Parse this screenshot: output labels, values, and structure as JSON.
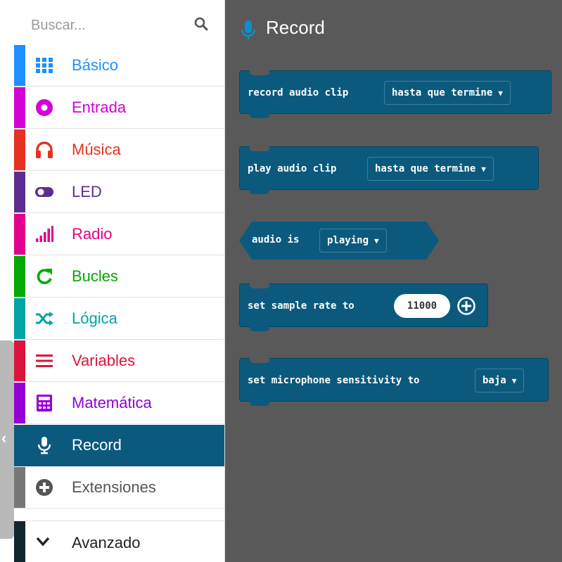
{
  "search": {
    "placeholder": "Buscar..."
  },
  "categories": [
    {
      "label": "Básico",
      "color": "#1e90ff",
      "icon": "grid-icon"
    },
    {
      "label": "Entrada",
      "color": "#d400d4",
      "icon": "circle-dot-icon"
    },
    {
      "label": "Música",
      "color": "#e63022",
      "icon": "headphones-icon"
    },
    {
      "label": "LED",
      "color": "#5c2d91",
      "icon": "toggle-icon"
    },
    {
      "label": "Radio",
      "color": "#e3008c",
      "icon": "signal-bars-icon"
    },
    {
      "label": "Bucles",
      "color": "#00aa00",
      "icon": "refresh-icon"
    },
    {
      "label": "Lógica",
      "color": "#00a4a6",
      "icon": "shuffle-icon"
    },
    {
      "label": "Variables",
      "color": "#dc143c",
      "icon": "list-icon"
    },
    {
      "label": "Matemática",
      "color": "#9400d3",
      "icon": "calculator-icon"
    },
    {
      "label": "Record",
      "color": "#0b5a7e",
      "icon": "microphone-icon",
      "selected": true
    },
    {
      "label": "Extensiones",
      "color": "#777777",
      "icon": "plus-circle-icon"
    }
  ],
  "advanced": {
    "label": "Avanzado",
    "icon": "chevron-down-icon"
  },
  "workspace": {
    "title": "Record",
    "title_icon": "microphone-icon"
  },
  "blocks": {
    "record_audio": {
      "text": "record audio clip",
      "dropdown": "hasta que termine"
    },
    "play_audio": {
      "text": "play audio clip",
      "dropdown": "hasta que termine"
    },
    "audio_is": {
      "text": "audio is",
      "dropdown": "playing"
    },
    "sample_rate": {
      "text": "set sample rate to",
      "value": "11000"
    },
    "mic_sensitivity": {
      "text": "set microphone sensitivity to",
      "dropdown": "baja"
    }
  }
}
